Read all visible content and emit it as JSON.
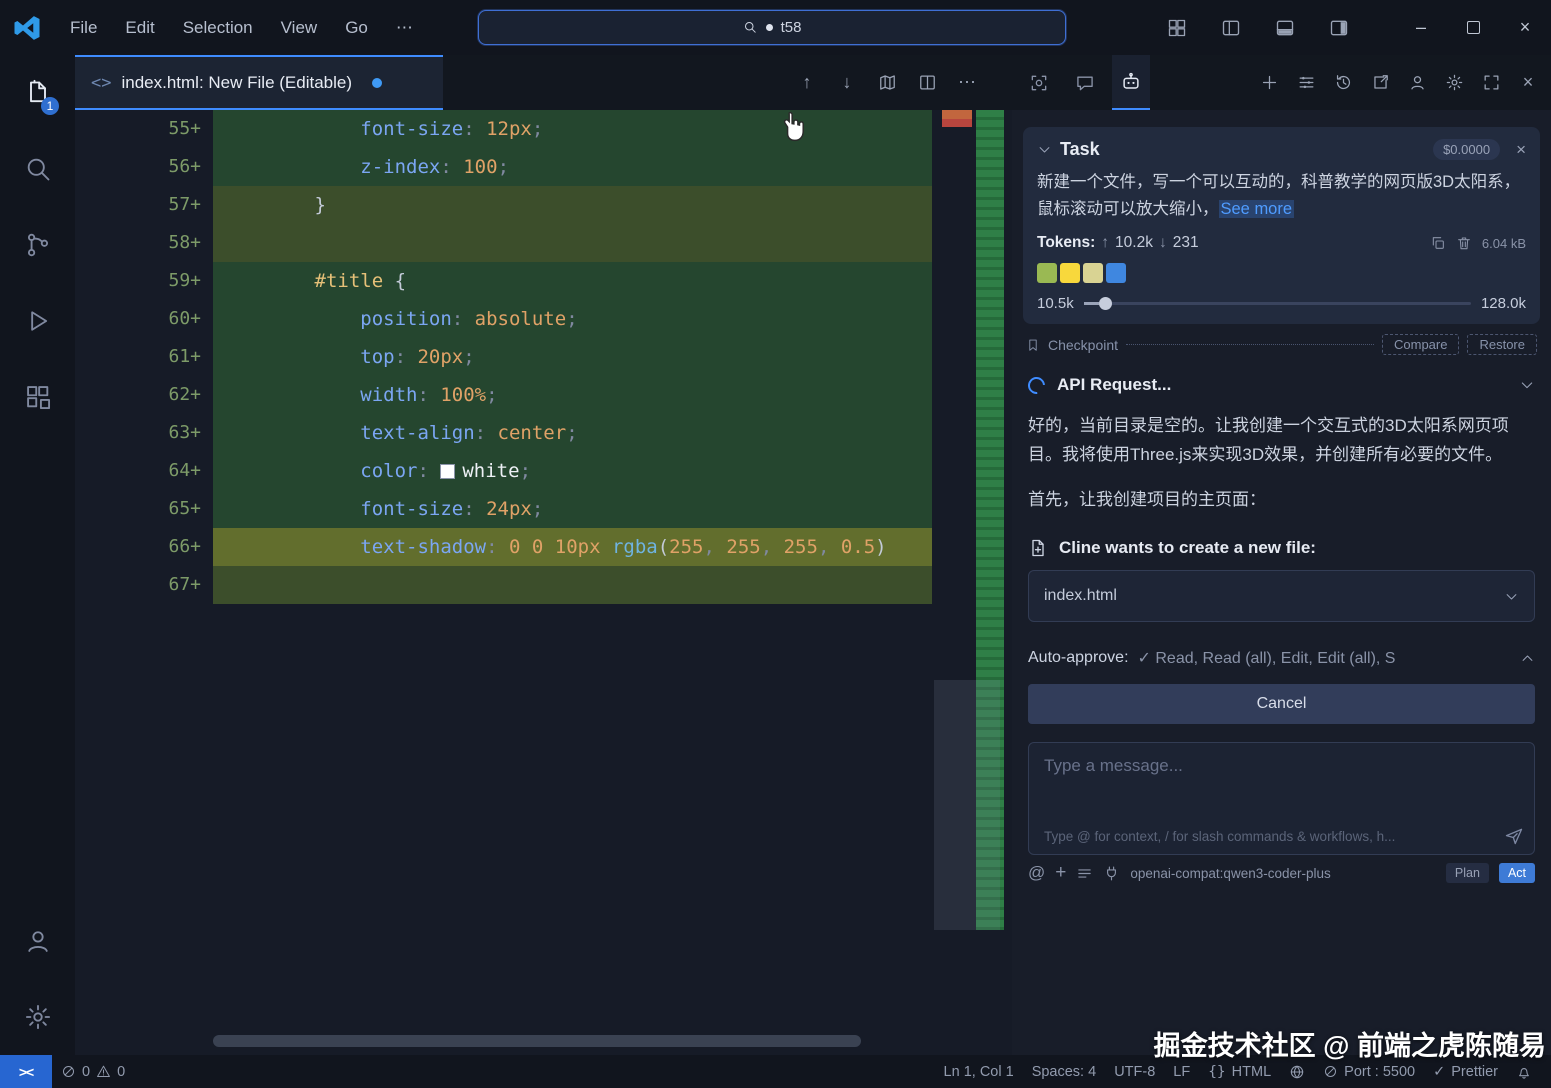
{
  "titlebar": {
    "menus": [
      {
        "label": "File"
      },
      {
        "label": "Edit"
      },
      {
        "label": "Selection"
      },
      {
        "label": "View"
      },
      {
        "label": "Go"
      },
      {
        "label": "⋯"
      }
    ],
    "search_value": "t58"
  },
  "activitybar": {
    "explorer_badge": "1"
  },
  "tab": {
    "label": "index.html: New File (Editable)"
  },
  "editor": {
    "lines": [
      {
        "num": "55",
        "indent": 12,
        "bg": "add",
        "tokens": [
          [
            "prop",
            "font-size"
          ],
          [
            "pun",
            ": "
          ],
          [
            "num",
            "12px"
          ],
          [
            "pun",
            ";"
          ]
        ]
      },
      {
        "num": "56",
        "indent": 12,
        "bg": "add",
        "tokens": [
          [
            "prop",
            "z-index"
          ],
          [
            "pun",
            ": "
          ],
          [
            "num",
            "100"
          ],
          [
            "pun",
            ";"
          ]
        ]
      },
      {
        "num": "57",
        "indent": 8,
        "bg": "add2",
        "tokens": [
          [
            "brace",
            "}"
          ]
        ]
      },
      {
        "num": "58",
        "indent": 0,
        "bg": "add2",
        "tokens": []
      },
      {
        "num": "59",
        "indent": 8,
        "bg": "add",
        "tokens": [
          [
            "sel",
            "#title"
          ],
          [
            "brace",
            " {"
          ]
        ]
      },
      {
        "num": "60",
        "indent": 12,
        "bg": "add",
        "tokens": [
          [
            "prop",
            "position"
          ],
          [
            "pun",
            ": "
          ],
          [
            "kw",
            "absolute"
          ],
          [
            "pun",
            ";"
          ]
        ]
      },
      {
        "num": "61",
        "indent": 12,
        "bg": "add",
        "tokens": [
          [
            "prop",
            "top"
          ],
          [
            "pun",
            ": "
          ],
          [
            "num",
            "20px"
          ],
          [
            "pun",
            ";"
          ]
        ]
      },
      {
        "num": "62",
        "indent": 12,
        "bg": "add",
        "tokens": [
          [
            "prop",
            "width"
          ],
          [
            "pun",
            ": "
          ],
          [
            "num",
            "100%"
          ],
          [
            "pun",
            ";"
          ]
        ]
      },
      {
        "num": "63",
        "indent": 12,
        "bg": "add",
        "tokens": [
          [
            "prop",
            "text-align"
          ],
          [
            "pun",
            ": "
          ],
          [
            "kw",
            "center"
          ],
          [
            "pun",
            ";"
          ]
        ]
      },
      {
        "num": "64",
        "indent": 12,
        "bg": "add",
        "tokens": [
          [
            "prop",
            "color"
          ],
          [
            "pun",
            ": "
          ],
          [
            "swatch",
            ""
          ],
          [
            "val",
            "white"
          ],
          [
            "pun",
            ";"
          ]
        ]
      },
      {
        "num": "65",
        "indent": 12,
        "bg": "add",
        "tokens": [
          [
            "prop",
            "font-size"
          ],
          [
            "pun",
            ": "
          ],
          [
            "num",
            "24px"
          ],
          [
            "pun",
            ";"
          ]
        ]
      },
      {
        "num": "66",
        "indent": 12,
        "bg": "cur",
        "tokens": [
          [
            "prop",
            "text-shadow"
          ],
          [
            "pun",
            ": "
          ],
          [
            "num",
            "0 0 10px "
          ],
          [
            "fn",
            "rgba"
          ],
          [
            "brace",
            "("
          ],
          [
            "num",
            "255"
          ],
          [
            "pun",
            ", "
          ],
          [
            "num",
            "255"
          ],
          [
            "pun",
            ", "
          ],
          [
            "num",
            "255"
          ],
          [
            "pun",
            ", "
          ],
          [
            "num",
            "0.5"
          ],
          [
            "brace",
            ")"
          ]
        ]
      },
      {
        "num": "67",
        "indent": 0,
        "bg": "add2",
        "tokens": []
      }
    ]
  },
  "task": {
    "title": "Task",
    "cost": "$0.0000",
    "description": "新建一个文件，写一个可以互动的，科普教学的网页版3D太阳系，鼠标滚动可以放大缩小，",
    "see_more": "See more",
    "tokens_label": "Tokens:",
    "tokens_up": "10.2k",
    "tokens_down": "231",
    "cache_size": "6.04 kB",
    "context_blocks": [
      "#9ab953",
      "#f8d83c",
      "#d9d393",
      "#3f87e0"
    ],
    "context_used": "10.5k",
    "context_max": "128.0k"
  },
  "checkpoint": {
    "label": "Checkpoint",
    "compare": "Compare",
    "restore": "Restore"
  },
  "api_request": {
    "label": "API Request..."
  },
  "messages": {
    "p1": "好的，当前目录是空的。让我创建一个交互式的3D太阳系网页项目。我将使用Three.js来实现3D效果，并创建所有必要的文件。",
    "p2": "首先，让我创建项目的主页面：",
    "create_file": "Cline wants to create a new file:",
    "file_name": "index.html"
  },
  "approve": {
    "label": "Auto-approve:",
    "check": "✓",
    "options": "Read, Read (all), Edit, Edit (all), S",
    "cancel": "Cancel"
  },
  "chat": {
    "placeholder": "Type a message...",
    "hint": "Type @ for context, / for slash commands & workflows, h...",
    "at": "@",
    "plus": "+",
    "model": "openai-compat:qwen3-coder-plus",
    "plan": "Plan",
    "act": "Act"
  },
  "statusbar": {
    "remote": "><",
    "errors": "0",
    "warnings": "0",
    "cursor": "Ln 1, Col 1",
    "spaces": "Spaces: 4",
    "encoding": "UTF-8",
    "eol": "LF",
    "lang_icon": "{}",
    "lang": "HTML",
    "port": "Port : 5500",
    "formatter_check": "✓",
    "formatter": "Prettier"
  },
  "watermark": "掘金技术社区 @ 前端之虎陈随易"
}
